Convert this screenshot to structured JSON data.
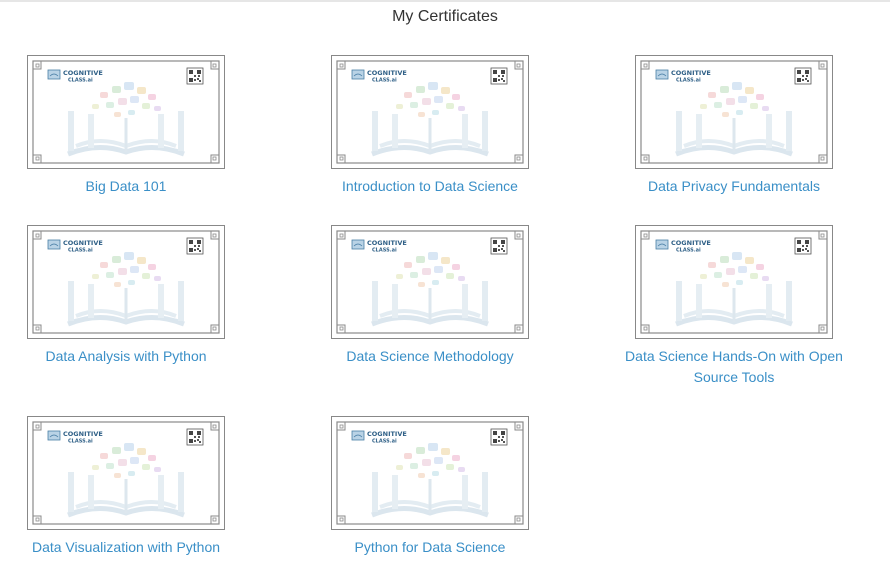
{
  "page": {
    "title": "My Certificates"
  },
  "certificate_logo": {
    "line1": "COGNITIVE",
    "line2": "CLASS.ai"
  },
  "colors": {
    "link": "#3a8fc7",
    "frame": "#888888",
    "title": "#333333"
  },
  "certificates": [
    {
      "name": "Big Data 101"
    },
    {
      "name": "Introduction to Data Science"
    },
    {
      "name": "Data Privacy Fundamentals"
    },
    {
      "name": "Data Analysis with Python"
    },
    {
      "name": "Data Science Methodology"
    },
    {
      "name": "Data Science Hands-On with Open Source Tools"
    },
    {
      "name": "Data Visualization with Python"
    },
    {
      "name": "Python for Data Science"
    }
  ]
}
